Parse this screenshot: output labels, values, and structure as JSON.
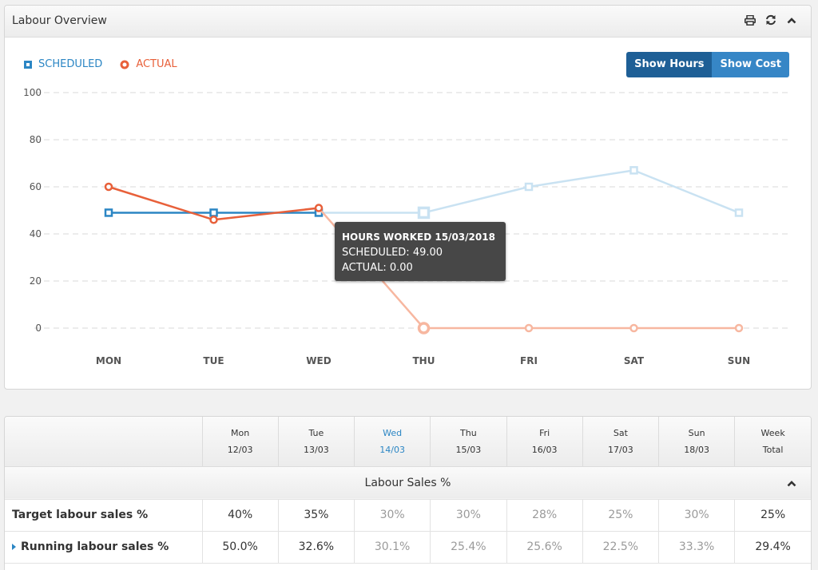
{
  "panel": {
    "title": "Labour Overview",
    "icons": [
      "print-icon",
      "refresh-icon",
      "chevron-up-icon"
    ]
  },
  "toggle": {
    "show_hours": "Show Hours",
    "show_cost": "Show Cost",
    "active": "Show Hours"
  },
  "colors": {
    "scheduled": "#2b86c4",
    "scheduled_faded": "#c9e2f2",
    "actual": "#e8603a",
    "actual_faded": "#f7b7a0",
    "accent": "#1e5f96"
  },
  "tooltip": {
    "title": "HOURS WORKED 15/03/2018",
    "scheduled": "SCHEDULED: 49.00",
    "actual": "ACTUAL: 0.00"
  },
  "chart_data": {
    "type": "line",
    "title": "Labour Overview",
    "xlabel": "",
    "ylabel": "",
    "categories": [
      "MON",
      "TUE",
      "WED",
      "THU",
      "FRI",
      "SAT",
      "SUN"
    ],
    "series": [
      {
        "name": "SCHEDULED",
        "values": [
          49,
          49,
          49,
          49,
          60,
          67,
          49
        ],
        "marker": "square"
      },
      {
        "name": "ACTUAL",
        "values": [
          60,
          46,
          51,
          0,
          0,
          0,
          0
        ],
        "marker": "circle"
      }
    ],
    "ylim": [
      0,
      100
    ],
    "yticks": [
      0,
      20,
      40,
      60,
      80,
      100
    ],
    "grid": true,
    "legend": "top-left",
    "highlight_index": 3,
    "faded_from_index": 3
  },
  "table": {
    "columns": [
      {
        "day": "Mon",
        "date": "12/03"
      },
      {
        "day": "Tue",
        "date": "13/03"
      },
      {
        "day": "Wed",
        "date": "14/03",
        "today": true
      },
      {
        "day": "Thu",
        "date": "15/03"
      },
      {
        "day": "Fri",
        "date": "16/03"
      },
      {
        "day": "Sat",
        "date": "17/03"
      },
      {
        "day": "Sun",
        "date": "18/03"
      },
      {
        "day": "Week",
        "date": "Total"
      }
    ],
    "section_title": "Labour Sales %",
    "rows": [
      {
        "label": "Target labour sales %",
        "values": [
          "40%",
          "35%",
          "30%",
          "30%",
          "28%",
          "25%",
          "30%",
          "25%"
        ]
      },
      {
        "label": "Running labour sales %",
        "values": [
          "50.0%",
          "32.6%",
          "30.1%",
          "25.4%",
          "25.6%",
          "22.5%",
          "33.3%",
          "29.4%"
        ],
        "expandable": true
      }
    ]
  }
}
